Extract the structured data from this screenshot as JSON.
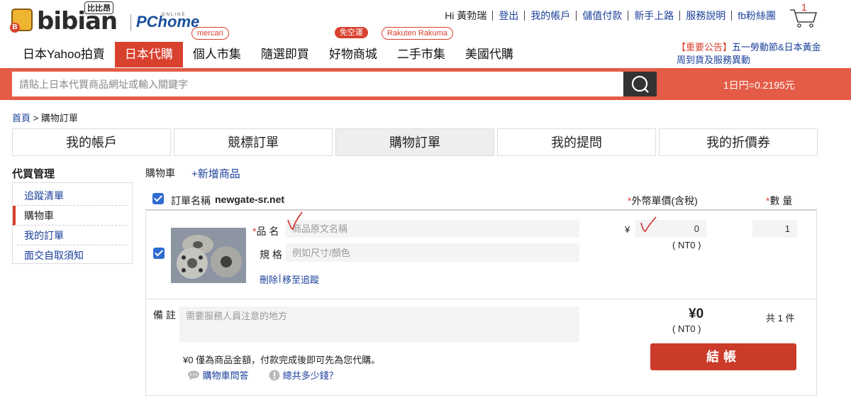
{
  "header": {
    "logo": {
      "text": "bibian",
      "sub": "比比昂",
      "partner": "PChome",
      "partner_sub": "ONLINE"
    },
    "greeting": "Hi 黃勃瑞",
    "links": [
      "登出",
      "我的帳戶",
      "儲值付款",
      "新手上路",
      "服務說明",
      "fb粉絲團"
    ],
    "cart_count": "1"
  },
  "nav": {
    "tabs": [
      {
        "label": "日本Yahoo拍賣"
      },
      {
        "label": "日本代購",
        "active": true
      },
      {
        "label": "個人市集",
        "tag": "mercari"
      },
      {
        "label": "隨選即買"
      },
      {
        "label": "好物商城",
        "tag": "免空運"
      },
      {
        "label": "二手市集",
        "tag": "Rakuten Rakuma"
      },
      {
        "label": "美國代購"
      }
    ],
    "notice_tag": "【重要公告】",
    "notice_text": "五一勞動節&日本黃金周到貨及服務異動"
  },
  "search": {
    "placeholder": "請貼上日本代買商品網址或輸入關鍵字",
    "rate": "1日円=0.2195元"
  },
  "breadcrumb": {
    "home": "首頁",
    "sep": ">",
    "current": "購物訂單"
  },
  "account_tabs": [
    {
      "label": "我的帳戶"
    },
    {
      "label": "競標訂單"
    },
    {
      "label": "購物訂單",
      "active": true
    },
    {
      "label": "我的提問"
    },
    {
      "label": "我的折價券"
    }
  ],
  "sidebar": {
    "title": "代買管理",
    "items": [
      {
        "label": "追蹤清單"
      },
      {
        "label": "購物車",
        "active": true
      },
      {
        "label": "我的訂單"
      },
      {
        "label": "面交自取須知"
      }
    ]
  },
  "cart": {
    "title": "購物車",
    "add_item": "+新增商品",
    "order_name_label": "訂單名稱",
    "order_name": "newgate-sr.net",
    "col_price": "外幣單價(含稅)",
    "col_qty": "數 量",
    "item": {
      "name_label": "品 名",
      "name_placeholder": "商品原文名稱",
      "spec_label": "規 格",
      "spec_placeholder": "例如尺寸/顏色",
      "delete": "刪除",
      "move_to_watch": "移至追蹤",
      "currency": "¥",
      "price": "0",
      "price_ntd": "( NT0 )",
      "qty": "1"
    },
    "note_label": "備 註",
    "note_placeholder": "需要服務人員注意的地方",
    "total_jpy": "¥0",
    "total_ntd": "( NT0 )",
    "total_count": "共 1 件",
    "disclaimer": "¥0 僅為商品金額，付款完成後即可先為您代購。",
    "faq_link": "購物車問答",
    "cost_link": "總共多少錢？",
    "checkout": "結帳"
  },
  "colors": {
    "brand_red": "#d9412f",
    "link_blue": "#1a3f9a",
    "checkbox_blue": "#2f6ccf"
  }
}
